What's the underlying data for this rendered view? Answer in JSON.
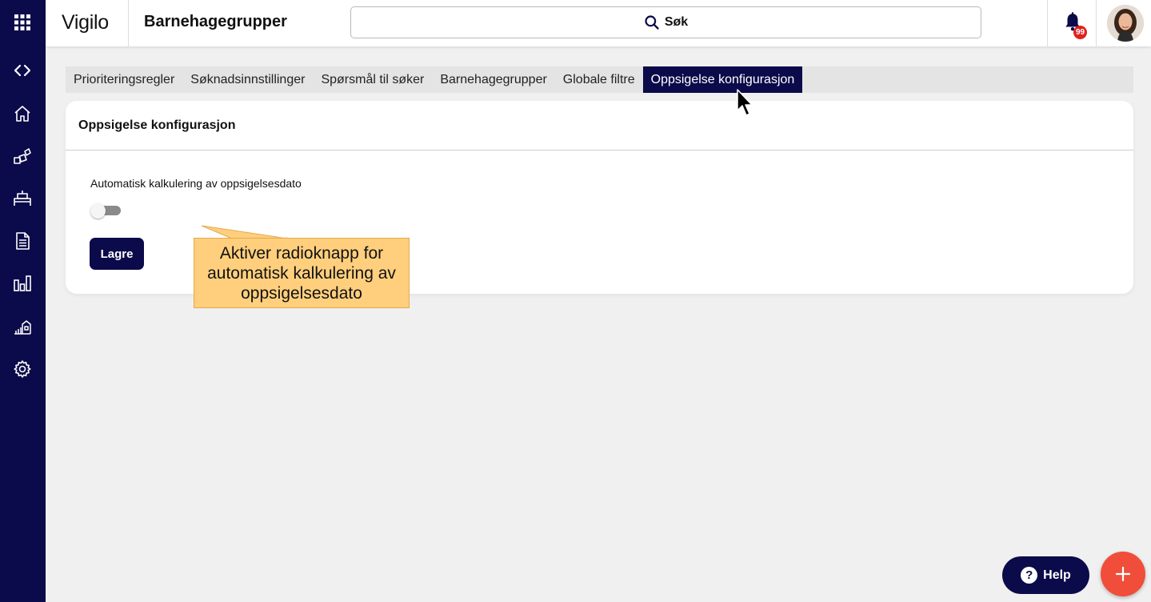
{
  "app": {
    "brand": "Vigilo",
    "page_title": "Barnehagegrupper"
  },
  "header": {
    "search_label": "Søk",
    "notification_count": "99"
  },
  "sidebar": {
    "items": [
      {
        "icon": "apps-grid-icon"
      },
      {
        "icon": "code-brackets-icon"
      },
      {
        "icon": "home-icon"
      },
      {
        "icon": "blocks-icon"
      },
      {
        "icon": "bed-icon"
      },
      {
        "icon": "document-icon"
      },
      {
        "icon": "bar-chart-icon"
      },
      {
        "icon": "building-chart-icon"
      },
      {
        "icon": "gear-icon"
      }
    ]
  },
  "tabs": [
    {
      "label": "Prioriteringsregler",
      "active": false
    },
    {
      "label": "Søknadsinnstillinger",
      "active": false
    },
    {
      "label": "Spørsmål til søker",
      "active": false
    },
    {
      "label": "Barnehagegrupper",
      "active": false
    },
    {
      "label": "Globale filtre",
      "active": false
    },
    {
      "label": "Oppsigelse konfigurasjon",
      "active": true
    }
  ],
  "card": {
    "title": "Oppsigelse konfigurasjon",
    "field_label": "Automatisk kalkulering av oppsigelsesdato",
    "toggle_on": false,
    "save_label": "Lagre"
  },
  "callout": {
    "text": "Aktiver radioknapp for automatisk kalkulering av oppsigelsesdato"
  },
  "floating": {
    "help_label": "Help",
    "help_icon_glyph": "?"
  },
  "colors": {
    "sidebar": "#0b0a4a",
    "primary": "#0b0a4a",
    "callout": "#ffcf7d",
    "add_button": "#f04e3a",
    "badge": "#e0211d"
  }
}
